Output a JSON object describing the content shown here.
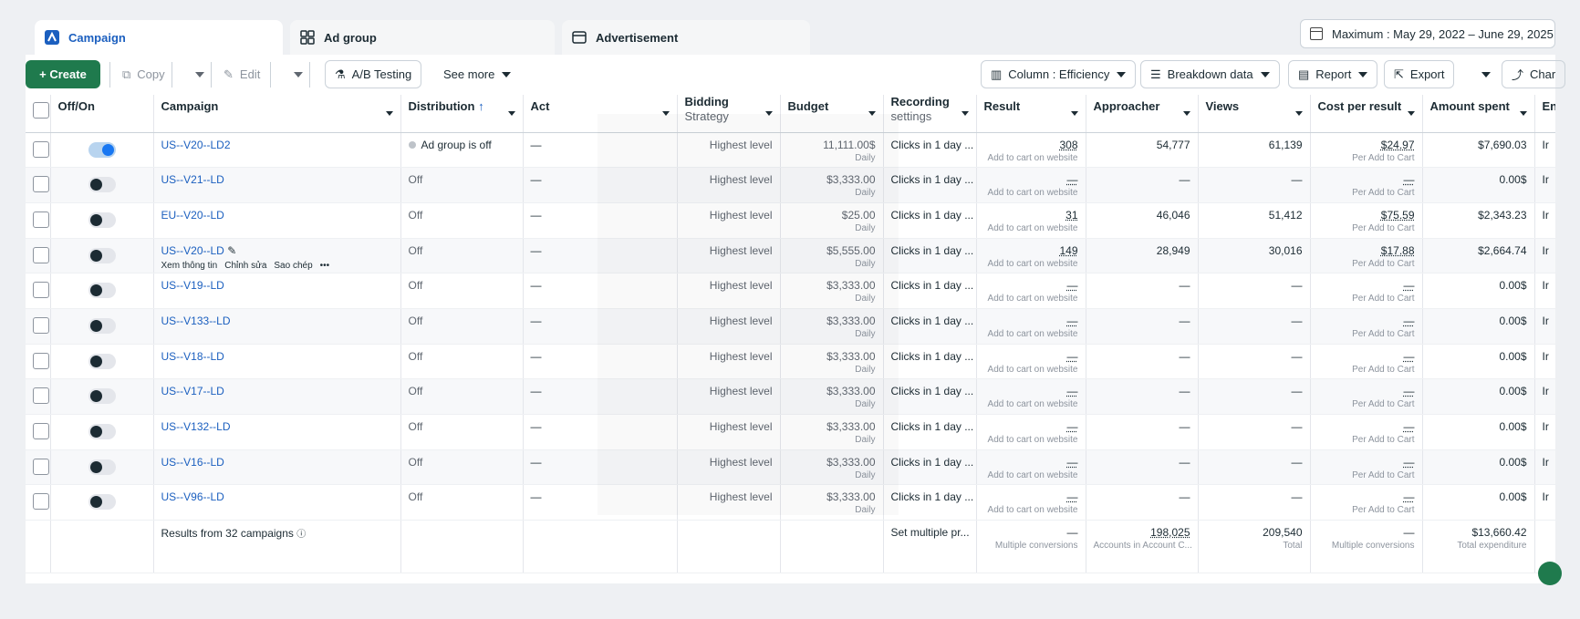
{
  "tabs": [
    {
      "label": "Campaign",
      "icon": "campaign-icon",
      "active": true
    },
    {
      "label": "Ad group",
      "icon": "ad-group-icon",
      "active": false
    },
    {
      "label": "Advertisement",
      "icon": "advertisement-icon",
      "active": false
    }
  ],
  "date_range": "Maximum : May 29, 2022 – June 29, 2025",
  "toolbar": {
    "create": "+ Create",
    "copy": "Copy",
    "edit": "Edit",
    "ab_testing": "A/B Testing",
    "see_more": "See more",
    "column": "Column : Efficiency",
    "breakdown": "Breakdown data",
    "report": "Report",
    "export": "Export",
    "chart": "Char"
  },
  "columns": {
    "off_on": "Off/On",
    "campaign": "Campaign",
    "distribution": "Distribution",
    "act": "Act",
    "bidding": "Bidding",
    "bidding_sub": "Strategy",
    "budget": "Budget",
    "recording": "Recording",
    "recording_sub": "settings",
    "result": "Result",
    "approacher": "Approacher",
    "views": "Views",
    "cost_per_result": "Cost per result",
    "amount_spent": "Amount spent",
    "end": "End"
  },
  "rows": [
    {
      "name": "US--V20--LD2",
      "on": true,
      "distribution": "Ad group is off",
      "act": "—",
      "bidding": "Highest level",
      "budget": "11,111.00$",
      "budget_sub": "Daily",
      "recording": "Clicks in 1 day ...",
      "result": "308",
      "result_sub": "Add to cart on website",
      "approacher": "54,777",
      "views": "61,139",
      "cpr": "$24.97",
      "cpr_sub": "Per Add to Cart",
      "spent": "$7,690.03",
      "end": "Ir"
    },
    {
      "name": "US--V21--LD",
      "on": false,
      "distribution": "Off",
      "act": "—",
      "bidding": "Highest level",
      "budget": "$3,333.00",
      "budget_sub": "Daily",
      "recording": "Clicks in 1 day ...",
      "result": "—",
      "result_sub": "Add to cart on website",
      "approacher": "—",
      "views": "—",
      "cpr": "—",
      "cpr_sub": "Per Add to Cart",
      "spent": "0.00$",
      "end": "Ir"
    },
    {
      "name": "EU--V20--LD",
      "on": false,
      "distribution": "Off",
      "act": "—",
      "bidding": "Highest level",
      "budget": "$25.00",
      "budget_sub": "Daily",
      "recording": "Clicks in 1 day ...",
      "result": "31",
      "result_sub": "Add to cart on website",
      "approacher": "46,046",
      "views": "51,412",
      "cpr": "$75.59",
      "cpr_sub": "Per Add to Cart",
      "spent": "$2,343.23",
      "end": "Ir"
    },
    {
      "name": "US--V20--LD",
      "on": false,
      "distribution": "Off",
      "act": "—",
      "bidding": "Highest level",
      "budget": "$5,555.00",
      "budget_sub": "Daily",
      "recording": "Clicks in 1 day ...",
      "result": "149",
      "result_sub": "Add to cart on website",
      "approacher": "28,949",
      "views": "30,016",
      "cpr": "$17.88",
      "cpr_sub": "Per Add to Cart",
      "spent": "$2,664.74",
      "end": "Ir",
      "actions": [
        "Xem thông tin",
        "Chỉnh sửa",
        "Sao chép"
      ]
    },
    {
      "name": "US--V19--LD",
      "on": false,
      "distribution": "Off",
      "act": "—",
      "bidding": "Highest level",
      "budget": "$3,333.00",
      "budget_sub": "Daily",
      "recording": "Clicks in 1 day ...",
      "result": "—",
      "result_sub": "Add to cart on website",
      "approacher": "—",
      "views": "—",
      "cpr": "—",
      "cpr_sub": "Per Add to Cart",
      "spent": "0.00$",
      "end": "Ir"
    },
    {
      "name": "US--V133--LD",
      "on": false,
      "distribution": "Off",
      "act": "—",
      "bidding": "Highest level",
      "budget": "$3,333.00",
      "budget_sub": "Daily",
      "recording": "Clicks in 1 day ...",
      "result": "—",
      "result_sub": "Add to cart on website",
      "approacher": "—",
      "views": "—",
      "cpr": "—",
      "cpr_sub": "Per Add to Cart",
      "spent": "0.00$",
      "end": "Ir"
    },
    {
      "name": "US--V18--LD",
      "on": false,
      "distribution": "Off",
      "act": "—",
      "bidding": "Highest level",
      "budget": "$3,333.00",
      "budget_sub": "Daily",
      "recording": "Clicks in 1 day ...",
      "result": "—",
      "result_sub": "Add to cart on website",
      "approacher": "—",
      "views": "—",
      "cpr": "—",
      "cpr_sub": "Per Add to Cart",
      "spent": "0.00$",
      "end": "Ir"
    },
    {
      "name": "US--V17--LD",
      "on": false,
      "distribution": "Off",
      "act": "—",
      "bidding": "Highest level",
      "budget": "$3,333.00",
      "budget_sub": "Daily",
      "recording": "Clicks in 1 day ...",
      "result": "—",
      "result_sub": "Add to cart on website",
      "approacher": "—",
      "views": "—",
      "cpr": "—",
      "cpr_sub": "Per Add to Cart",
      "spent": "0.00$",
      "end": "Ir"
    },
    {
      "name": "US--V132--LD",
      "on": false,
      "distribution": "Off",
      "act": "—",
      "bidding": "Highest level",
      "budget": "$3,333.00",
      "budget_sub": "Daily",
      "recording": "Clicks in 1 day ...",
      "result": "—",
      "result_sub": "Add to cart on website",
      "approacher": "—",
      "views": "—",
      "cpr": "—",
      "cpr_sub": "Per Add to Cart",
      "spent": "0.00$",
      "end": "Ir"
    },
    {
      "name": "US--V16--LD",
      "on": false,
      "distribution": "Off",
      "act": "—",
      "bidding": "Highest level",
      "budget": "$3,333.00",
      "budget_sub": "Daily",
      "recording": "Clicks in 1 day ...",
      "result": "—",
      "result_sub": "Add to cart on website",
      "approacher": "—",
      "views": "—",
      "cpr": "—",
      "cpr_sub": "Per Add to Cart",
      "spent": "0.00$",
      "end": "Ir"
    },
    {
      "name": "US--V96--LD",
      "on": false,
      "distribution": "Off",
      "act": "—",
      "bidding": "Highest level",
      "budget": "$3,333.00",
      "budget_sub": "Daily",
      "recording": "Clicks in 1 day ...",
      "result": "—",
      "result_sub": "Add to cart on website",
      "approacher": "—",
      "views": "—",
      "cpr": "—",
      "cpr_sub": "Per Add to Cart",
      "spent": "0.00$",
      "end": "Ir"
    }
  ],
  "footer": {
    "label": "Results from 32 campaigns",
    "recording": "Set multiple pr...",
    "result": "—",
    "result_sub": "Multiple conversions",
    "approacher": "198,025",
    "approacher_sub": "Accounts in Account C...",
    "views": "209,540",
    "views_sub": "Total",
    "cpr": "—",
    "cpr_sub": "Multiple conversions",
    "spent": "$13,660.42",
    "spent_sub": "Total expenditure"
  },
  "colors": {
    "accent": "#1b5fbf",
    "create": "#1f7a4d",
    "toggle_on": "#1877f2"
  }
}
